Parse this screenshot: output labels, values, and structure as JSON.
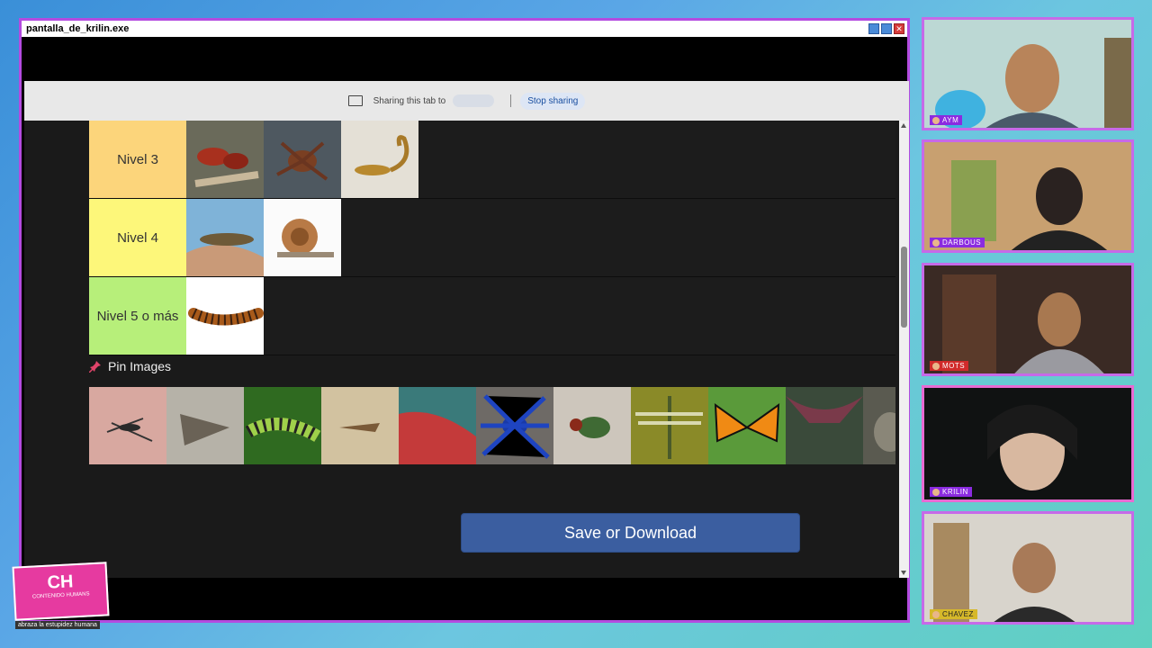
{
  "window": {
    "title": "pantalla_de_krilin.exe"
  },
  "sharebar": {
    "text": "Sharing this tab to",
    "stop_label": "Stop sharing"
  },
  "tiers": [
    {
      "label": "Nivel 3",
      "color": "#fcd57b"
    },
    {
      "label": "Nivel 4",
      "color": "#fdf77a"
    },
    {
      "label": "Nivel 5 o más",
      "color": "#b7ef7a"
    }
  ],
  "pin": {
    "title": "Pin Images"
  },
  "save_label": "Save or Download",
  "participants": [
    {
      "name": "AYM"
    },
    {
      "name": "DARBOUS"
    },
    {
      "name": "MOTS"
    },
    {
      "name": "KRILIN"
    },
    {
      "name": "CHAVEZ"
    }
  ],
  "logo": {
    "main": "CH",
    "sub": "CONTENIDO HUMANS",
    "tagline": "abraza la estupidez humana"
  }
}
